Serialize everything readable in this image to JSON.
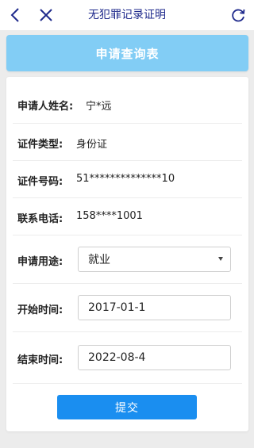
{
  "topbar": {
    "title": "无犯罪记录证明",
    "back_icon": "chevron-left-icon",
    "close_icon": "close-icon",
    "refresh_icon": "refresh-icon",
    "accent": "#1f2a8c"
  },
  "header": {
    "title": "申请查询表",
    "color": "#82cdf5"
  },
  "form": {
    "applicant_name": {
      "label": "申请人姓名:",
      "value": "宁*远"
    },
    "id_type": {
      "label": "证件类型:",
      "value": "身份证"
    },
    "id_number": {
      "label": "证件号码:",
      "value": "51**************10"
    },
    "phone": {
      "label": "联系电话:",
      "value": "158****1001"
    },
    "purpose": {
      "label": "申请用途:",
      "value": "就业"
    },
    "start_time": {
      "label": "开始时间:",
      "value": "2017-01-1"
    },
    "end_time": {
      "label": "结束时间:",
      "value": "2022-08-4"
    },
    "submit_label": "提交",
    "submit_color": "#1a8ef0"
  }
}
